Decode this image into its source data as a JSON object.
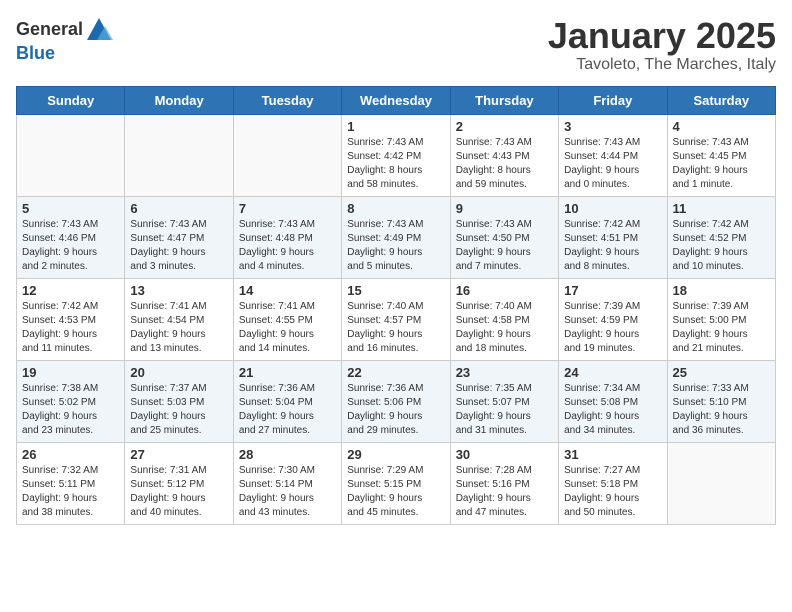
{
  "header": {
    "logo_general": "General",
    "logo_blue": "Blue",
    "month_title": "January 2025",
    "subtitle": "Tavoleto, The Marches, Italy"
  },
  "weekdays": [
    "Sunday",
    "Monday",
    "Tuesday",
    "Wednesday",
    "Thursday",
    "Friday",
    "Saturday"
  ],
  "weeks": [
    [
      {
        "day": "",
        "content": ""
      },
      {
        "day": "",
        "content": ""
      },
      {
        "day": "",
        "content": ""
      },
      {
        "day": "1",
        "content": "Sunrise: 7:43 AM\nSunset: 4:42 PM\nDaylight: 8 hours\nand 58 minutes."
      },
      {
        "day": "2",
        "content": "Sunrise: 7:43 AM\nSunset: 4:43 PM\nDaylight: 8 hours\nand 59 minutes."
      },
      {
        "day": "3",
        "content": "Sunrise: 7:43 AM\nSunset: 4:44 PM\nDaylight: 9 hours\nand 0 minutes."
      },
      {
        "day": "4",
        "content": "Sunrise: 7:43 AM\nSunset: 4:45 PM\nDaylight: 9 hours\nand 1 minute."
      }
    ],
    [
      {
        "day": "5",
        "content": "Sunrise: 7:43 AM\nSunset: 4:46 PM\nDaylight: 9 hours\nand 2 minutes."
      },
      {
        "day": "6",
        "content": "Sunrise: 7:43 AM\nSunset: 4:47 PM\nDaylight: 9 hours\nand 3 minutes."
      },
      {
        "day": "7",
        "content": "Sunrise: 7:43 AM\nSunset: 4:48 PM\nDaylight: 9 hours\nand 4 minutes."
      },
      {
        "day": "8",
        "content": "Sunrise: 7:43 AM\nSunset: 4:49 PM\nDaylight: 9 hours\nand 5 minutes."
      },
      {
        "day": "9",
        "content": "Sunrise: 7:43 AM\nSunset: 4:50 PM\nDaylight: 9 hours\nand 7 minutes."
      },
      {
        "day": "10",
        "content": "Sunrise: 7:42 AM\nSunset: 4:51 PM\nDaylight: 9 hours\nand 8 minutes."
      },
      {
        "day": "11",
        "content": "Sunrise: 7:42 AM\nSunset: 4:52 PM\nDaylight: 9 hours\nand 10 minutes."
      }
    ],
    [
      {
        "day": "12",
        "content": "Sunrise: 7:42 AM\nSunset: 4:53 PM\nDaylight: 9 hours\nand 11 minutes."
      },
      {
        "day": "13",
        "content": "Sunrise: 7:41 AM\nSunset: 4:54 PM\nDaylight: 9 hours\nand 13 minutes."
      },
      {
        "day": "14",
        "content": "Sunrise: 7:41 AM\nSunset: 4:55 PM\nDaylight: 9 hours\nand 14 minutes."
      },
      {
        "day": "15",
        "content": "Sunrise: 7:40 AM\nSunset: 4:57 PM\nDaylight: 9 hours\nand 16 minutes."
      },
      {
        "day": "16",
        "content": "Sunrise: 7:40 AM\nSunset: 4:58 PM\nDaylight: 9 hours\nand 18 minutes."
      },
      {
        "day": "17",
        "content": "Sunrise: 7:39 AM\nSunset: 4:59 PM\nDaylight: 9 hours\nand 19 minutes."
      },
      {
        "day": "18",
        "content": "Sunrise: 7:39 AM\nSunset: 5:00 PM\nDaylight: 9 hours\nand 21 minutes."
      }
    ],
    [
      {
        "day": "19",
        "content": "Sunrise: 7:38 AM\nSunset: 5:02 PM\nDaylight: 9 hours\nand 23 minutes."
      },
      {
        "day": "20",
        "content": "Sunrise: 7:37 AM\nSunset: 5:03 PM\nDaylight: 9 hours\nand 25 minutes."
      },
      {
        "day": "21",
        "content": "Sunrise: 7:36 AM\nSunset: 5:04 PM\nDaylight: 9 hours\nand 27 minutes."
      },
      {
        "day": "22",
        "content": "Sunrise: 7:36 AM\nSunset: 5:06 PM\nDaylight: 9 hours\nand 29 minutes."
      },
      {
        "day": "23",
        "content": "Sunrise: 7:35 AM\nSunset: 5:07 PM\nDaylight: 9 hours\nand 31 minutes."
      },
      {
        "day": "24",
        "content": "Sunrise: 7:34 AM\nSunset: 5:08 PM\nDaylight: 9 hours\nand 34 minutes."
      },
      {
        "day": "25",
        "content": "Sunrise: 7:33 AM\nSunset: 5:10 PM\nDaylight: 9 hours\nand 36 minutes."
      }
    ],
    [
      {
        "day": "26",
        "content": "Sunrise: 7:32 AM\nSunset: 5:11 PM\nDaylight: 9 hours\nand 38 minutes."
      },
      {
        "day": "27",
        "content": "Sunrise: 7:31 AM\nSunset: 5:12 PM\nDaylight: 9 hours\nand 40 minutes."
      },
      {
        "day": "28",
        "content": "Sunrise: 7:30 AM\nSunset: 5:14 PM\nDaylight: 9 hours\nand 43 minutes."
      },
      {
        "day": "29",
        "content": "Sunrise: 7:29 AM\nSunset: 5:15 PM\nDaylight: 9 hours\nand 45 minutes."
      },
      {
        "day": "30",
        "content": "Sunrise: 7:28 AM\nSunset: 5:16 PM\nDaylight: 9 hours\nand 47 minutes."
      },
      {
        "day": "31",
        "content": "Sunrise: 7:27 AM\nSunset: 5:18 PM\nDaylight: 9 hours\nand 50 minutes."
      },
      {
        "day": "",
        "content": ""
      }
    ]
  ]
}
